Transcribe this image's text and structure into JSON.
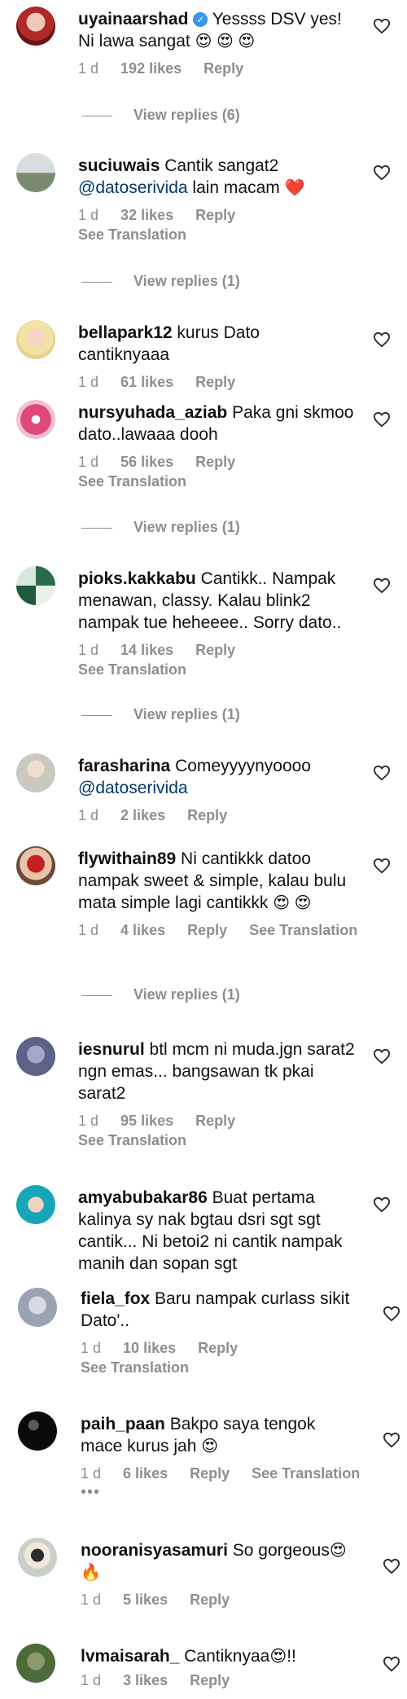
{
  "colors": {
    "link": "#00376b",
    "muted": "#8e8e8e",
    "verified": "#3897f0",
    "heart": "#e53935"
  },
  "labels": {
    "reply": "Reply",
    "see_translation": "See Translation"
  },
  "comments": [
    {
      "username": "uyainaarshad",
      "verified": true,
      "text": "Yessss DSV yes! Ni lawa sangat",
      "emoji": "😍 😍 😍",
      "age": "1 d",
      "likes": "192 likes",
      "view_replies": "View replies (6)"
    },
    {
      "username": "suciuwais",
      "text": "Cantik sangat2",
      "mention": "@datoserivida",
      "text2": "lain macam",
      "emoji": "❤️",
      "age": "1 d",
      "likes": "32 likes",
      "see_translation": "See Translation",
      "view_replies": "View replies (1)"
    },
    {
      "username": "bellapark12",
      "text": "kurus Dato cantiknyaaa",
      "age": "1 d",
      "likes": "61 likes"
    },
    {
      "username": "nursyuhada_aziab",
      "text": "Paka gni skmoo dato..lawaaa dooh",
      "age": "1 d",
      "likes": "56 likes",
      "see_translation": "See Translation",
      "view_replies": "View replies (1)"
    },
    {
      "username": "pioks.kakkabu",
      "text": "Cantikk.. Nampak menawan, classy. Kalau blink2 nampak tue heheeee.. Sorry dato..",
      "age": "1 d",
      "likes": "14 likes",
      "see_translation": "See Translation",
      "view_replies": "View replies (1)"
    },
    {
      "username": "farasharina",
      "text": "Comeyyyynyoooo",
      "mention": "@datoserivida",
      "age": "1 d",
      "likes": "2 likes"
    },
    {
      "username": "flywithain89",
      "text": "Ni cantikkk datoo nampak sweet & simple, kalau bulu mata simple lagi cantikkk",
      "emoji": "😍 😍",
      "age": "1 d",
      "likes": "4 likes",
      "see_translation_inline": "See Translation",
      "view_replies": "View replies (1)"
    },
    {
      "username": "iesnurul",
      "text": "btl mcm ni muda.jgn sarat2 ngn emas... bangsawan tk pkai sarat2",
      "age": "1 d",
      "likes": "95 likes",
      "see_translation": "See Translation"
    },
    {
      "username": "amyabubakar86",
      "text": "Buat pertama kalinya sy nak bgtau dsri sgt sgt cantik... Ni betoi2 ni cantik nampak manih dan sopan sgt"
    },
    {
      "username": "fiela_fox",
      "text": "Baru nampak curlass sikit Dato'..",
      "age": "1 d",
      "likes": "10 likes",
      "see_translation": "See Translation"
    },
    {
      "username": "paih_paan",
      "text": "Bakpo saya tengok mace kurus jah",
      "emoji": "😍",
      "age": "1 d",
      "likes": "6 likes",
      "see_translation_inline": "See Translation",
      "more": "•••"
    },
    {
      "username": "nooranisyasamuri",
      "text": "So gorgeous",
      "emoji": "😍",
      "emoji2": "🔥",
      "age": "1 d",
      "likes": "5 likes"
    },
    {
      "username": "lvmaisarah_",
      "text": "Cantiknyaa",
      "emoji": "😍",
      "text_after": "!!",
      "age": "1 d",
      "likes": "3 likes"
    }
  ]
}
